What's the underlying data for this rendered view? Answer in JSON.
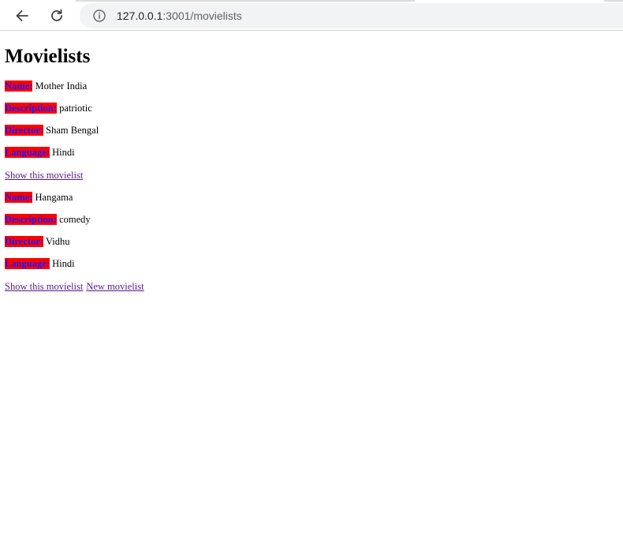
{
  "browser": {
    "url_host": "127.0.0.1",
    "url_rest": ":3001/movielists"
  },
  "page": {
    "title": "Movielists",
    "labels": {
      "name": "Name:",
      "description": "Description:",
      "director": "Director:",
      "language": "Language:"
    },
    "movies": [
      {
        "name": "Mother India",
        "description": "patriotic",
        "director": "Sham Bengal",
        "language": "Hindi",
        "show_link": "Show this movielist"
      },
      {
        "name": "Hangama",
        "description": "comedy",
        "director": "Vidhu",
        "language": "Hindi",
        "show_link": "Show this movielist"
      }
    ],
    "new_link": "New movielist"
  },
  "colors": {
    "label_bg": "#ff0000",
    "label_text": "#1a1aff",
    "visited_link": "#551a8b"
  }
}
